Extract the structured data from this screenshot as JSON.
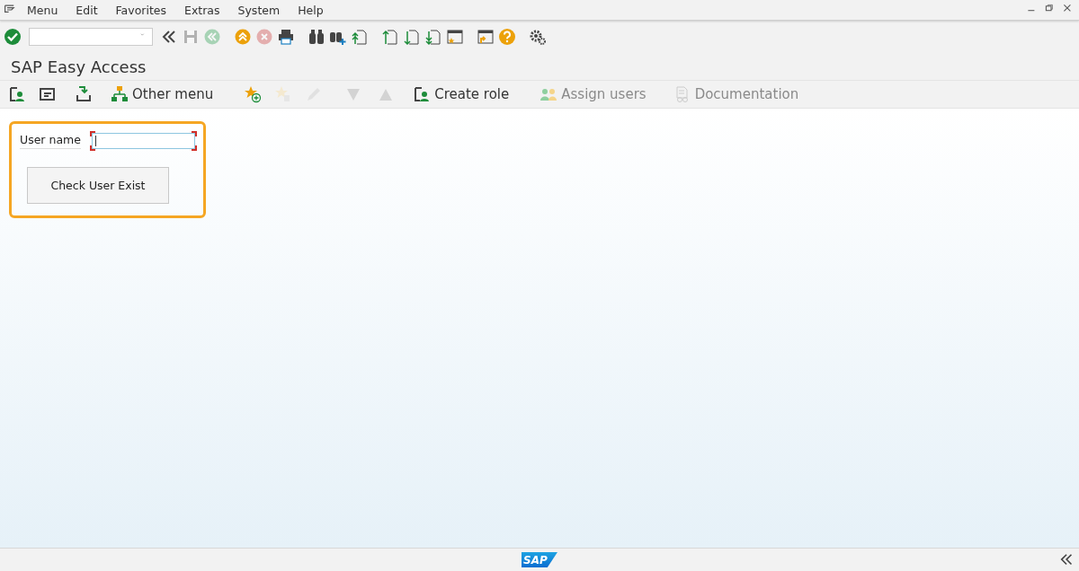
{
  "menu_bar": {
    "items": [
      "Menu",
      "Edit",
      "Favorites",
      "Extras",
      "System",
      "Help"
    ]
  },
  "standard_toolbar": {
    "buttons": [
      {
        "disabled": false
      },
      {
        "disabled": false
      },
      {
        "disabled": true
      },
      {
        "disabled": true
      },
      {
        "disabled": false
      },
      {
        "disabled": true
      },
      {
        "disabled": false
      },
      {
        "disabled": false
      },
      {
        "disabled": false
      },
      {
        "disabled": false
      },
      {
        "disabled": false
      },
      {
        "disabled": false
      },
      {
        "disabled": false
      },
      {
        "disabled": false
      },
      {
        "disabled": false
      },
      {
        "disabled": false
      },
      {
        "disabled": false
      }
    ]
  },
  "title": "SAP Easy Access",
  "application_toolbar": [
    {
      "disabled": false
    },
    {
      "disabled": false
    },
    {
      "disabled": false
    },
    {
      "label": "Other menu",
      "disabled": false
    },
    {
      "disabled": false
    },
    {
      "disabled": true
    },
    {
      "disabled": true
    },
    {
      "disabled": true
    },
    {
      "disabled": true
    },
    {
      "label": "Create role",
      "disabled": false
    },
    {
      "label": "Assign users",
      "disabled": true
    },
    {
      "label": "Documentation",
      "disabled": true
    }
  ],
  "form": {
    "field": {
      "label": "User name",
      "required": true,
      "focused": true
    },
    "button": "Check User Exist"
  },
  "status_bar": {
    "logo_text": "SAP"
  }
}
